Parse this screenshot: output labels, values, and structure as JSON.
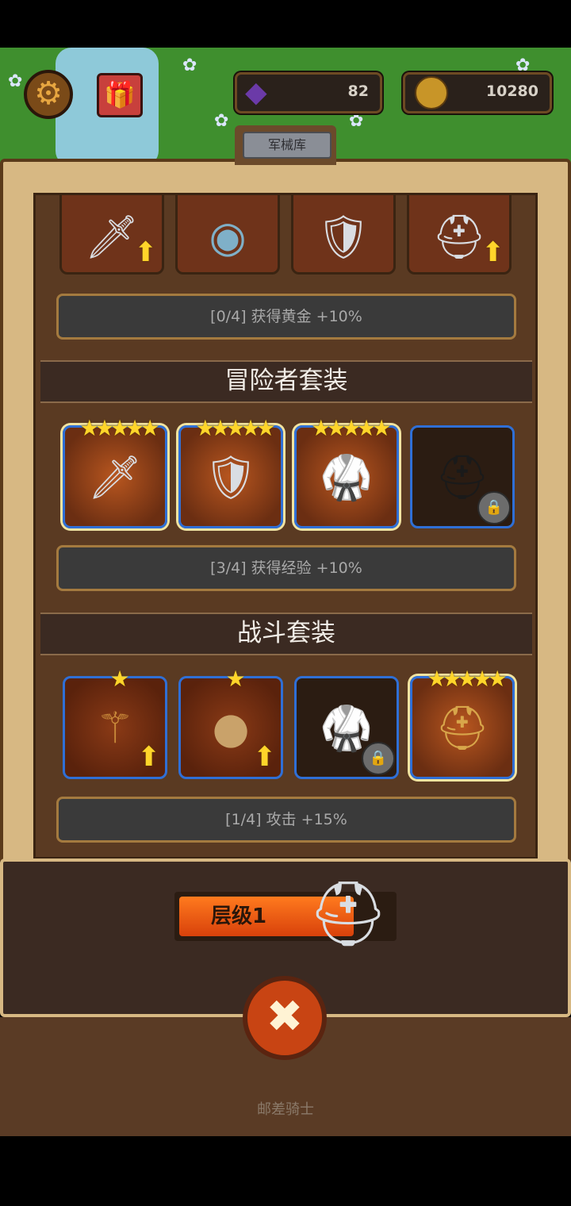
{
  "header": {
    "gems": "82",
    "coins": "10280",
    "tab_label": "军械库"
  },
  "sets": [
    {
      "name": "",
      "bonus": "[0/4] 获得黄金 +10%",
      "items": [
        {
          "icon": "sword-icon",
          "stars": 0,
          "state": "owned-upgradable"
        },
        {
          "icon": "round-shield-icon",
          "stars": 0,
          "state": "owned"
        },
        {
          "icon": "armor-icon",
          "stars": 0,
          "state": "owned"
        },
        {
          "icon": "helmet-icon",
          "stars": 0,
          "state": "owned-upgradable"
        }
      ]
    },
    {
      "name": "冒险者套装",
      "bonus": "[3/4] 获得经验 +10%",
      "items": [
        {
          "icon": "dagger-icon",
          "stars": 5,
          "state": "owned"
        },
        {
          "icon": "shield-icon",
          "stars": 5,
          "state": "owned"
        },
        {
          "icon": "armor-icon",
          "stars": 5,
          "state": "owned"
        },
        {
          "icon": "helmet-icon",
          "stars": 0,
          "state": "locked"
        }
      ]
    },
    {
      "name": "战斗套装",
      "bonus": "[1/4] 攻击 +15%",
      "items": [
        {
          "icon": "mace-icon",
          "stars": 1,
          "state": "owned-upgradable"
        },
        {
          "icon": "round-shield-icon",
          "stars": 1,
          "state": "owned-upgradable"
        },
        {
          "icon": "armor-icon",
          "stars": 0,
          "state": "locked"
        },
        {
          "icon": "helmet-icon",
          "stars": 5,
          "state": "owned"
        }
      ]
    }
  ],
  "bottom": {
    "level_label": "层级1",
    "footer_text": "邮差骑士"
  },
  "colors": {
    "accent_orange": "#d8410b",
    "slot_border_blue": "#2f6fd6",
    "star_gold": "#ffd52a"
  }
}
